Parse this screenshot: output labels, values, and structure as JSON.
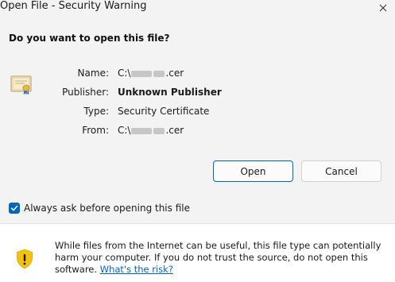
{
  "window": {
    "title": "Open File - Security Warning",
    "close_icon": "close-icon"
  },
  "prompt": {
    "question": "Do you want to open this file?"
  },
  "file_info": {
    "icon": "certificate-icon",
    "name_label": "Name:",
    "name_prefix": "C:\\",
    "name_suffix": ".cer",
    "publisher_label": "Publisher:",
    "publisher_value": "Unknown Publisher",
    "type_label": "Type:",
    "type_value": "Security Certificate",
    "from_label": "From:",
    "from_prefix": "C:\\",
    "from_suffix": ".cer"
  },
  "buttons": {
    "open_label": "Open",
    "cancel_label": "Cancel"
  },
  "options": {
    "always_ask_label": "Always ask before opening this file",
    "always_ask_checked": true
  },
  "footer": {
    "icon": "shield-warning-icon",
    "warning_text": "While files from the Internet can be useful, this file type can potentially harm your computer. If you do not trust the source, do not open this software.",
    "risk_link": "What's the risk?"
  },
  "colors": {
    "accent": "#0067c0",
    "shield_yellow": "#f2c20f",
    "dialog_bg": "#f3f3f3",
    "footer_bg": "#ffffff"
  }
}
